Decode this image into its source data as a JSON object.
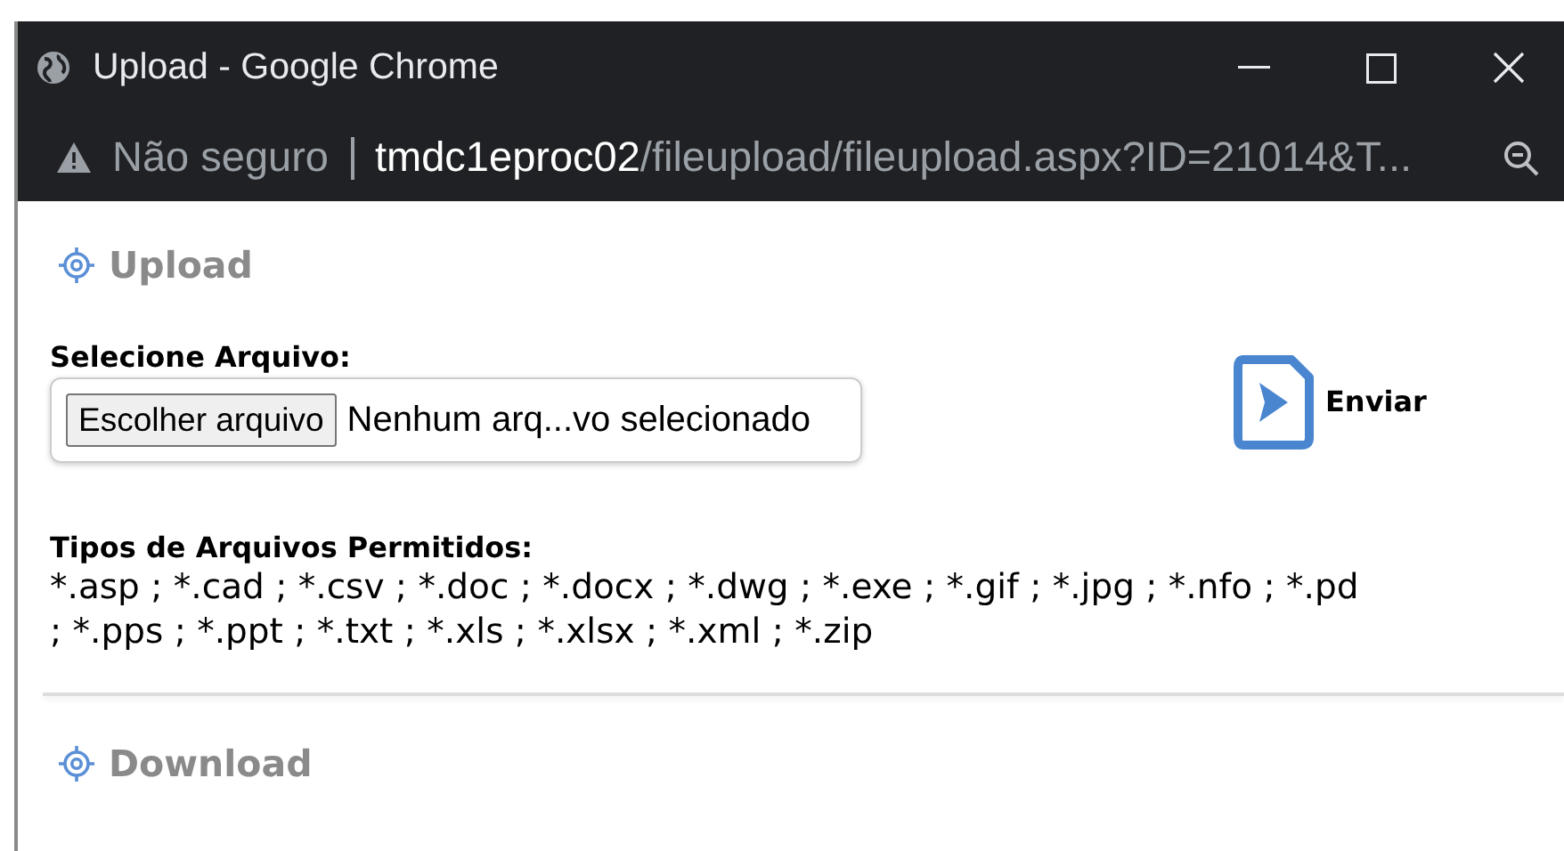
{
  "window": {
    "title": "Upload - Google Chrome"
  },
  "address_bar": {
    "security": "Não seguro",
    "host": "tmdc1eproc02",
    "path": "/fileupload/fileupload.aspx?ID=21014&T..."
  },
  "upload": {
    "heading": "Upload",
    "label": "Selecione Arquivo:",
    "choose_button": "Escolher arquivo",
    "file_status": "Nenhum arq...vo selecionado",
    "send_button": "Enviar"
  },
  "allowed_types": {
    "label": "Tipos de Arquivos Permitidos:",
    "lines": [
      "*.asp ; *.cad ; *.csv ; *.doc ; *.docx ; *.dwg ; *.exe ; *.gif ; *.jpg ; *.nfo ; *.pd",
      "; *.pps ; *.ppt ; *.txt ; *.xls ; *.xlsx ; *.xml ; *.zip"
    ]
  },
  "download": {
    "heading": "Download"
  }
}
